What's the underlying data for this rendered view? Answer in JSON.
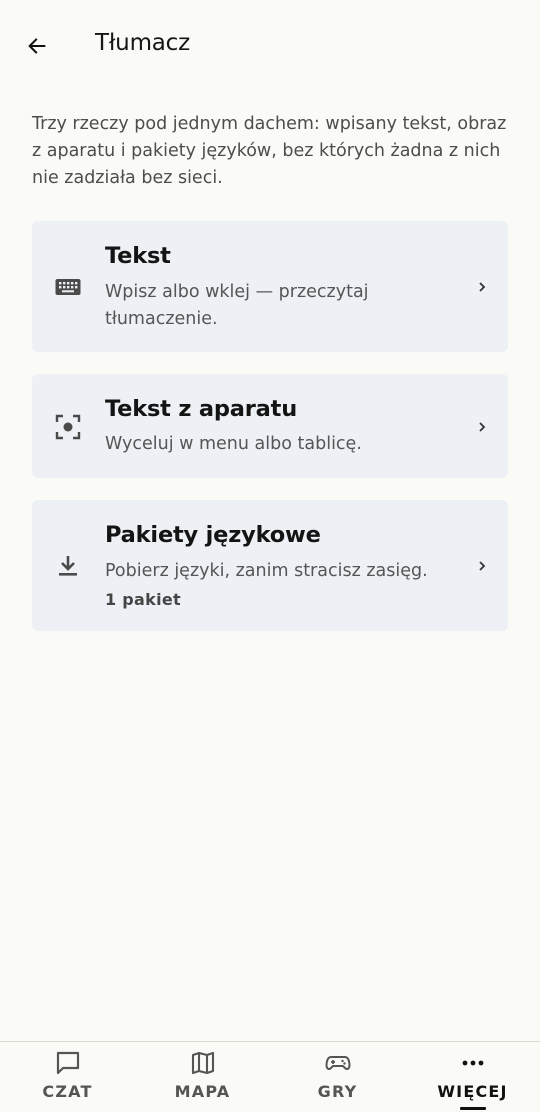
{
  "header": {
    "back_icon": "arrow-left-icon",
    "title": "Tłumacz"
  },
  "intro": "Trzy rzeczy pod jednym dachem: wpisany tekst, obraz z aparatu i pakiety języków, bez których żadna z nich nie zadziała bez sieci.",
  "cards": [
    {
      "icon": "keyboard-icon",
      "title": "Tekst",
      "subtitle": "Wpisz albo wklej — przeczytaj tłumaczenie."
    },
    {
      "icon": "camera-scan-icon",
      "title": "Tekst z aparatu",
      "subtitle": "Wyceluj w menu albo tablicę."
    },
    {
      "icon": "download-icon",
      "title": "Pakiety językowe",
      "subtitle": "Pobierz języki, zanim stracisz zasięg.",
      "meta": "1 pakiet"
    }
  ],
  "bottom_nav": {
    "items": [
      {
        "icon": "chat-bubble-icon",
        "label": "CZAT"
      },
      {
        "icon": "map-icon",
        "label": "MAPA"
      },
      {
        "icon": "gamepad-icon",
        "label": "GRY"
      },
      {
        "icon": "more-dots-icon",
        "label": "WIĘCEJ",
        "active": true
      }
    ]
  },
  "colors": {
    "background": "#fafaf6",
    "card": "#edf1f6",
    "text_primary": "#141414",
    "text_secondary": "#555555"
  }
}
